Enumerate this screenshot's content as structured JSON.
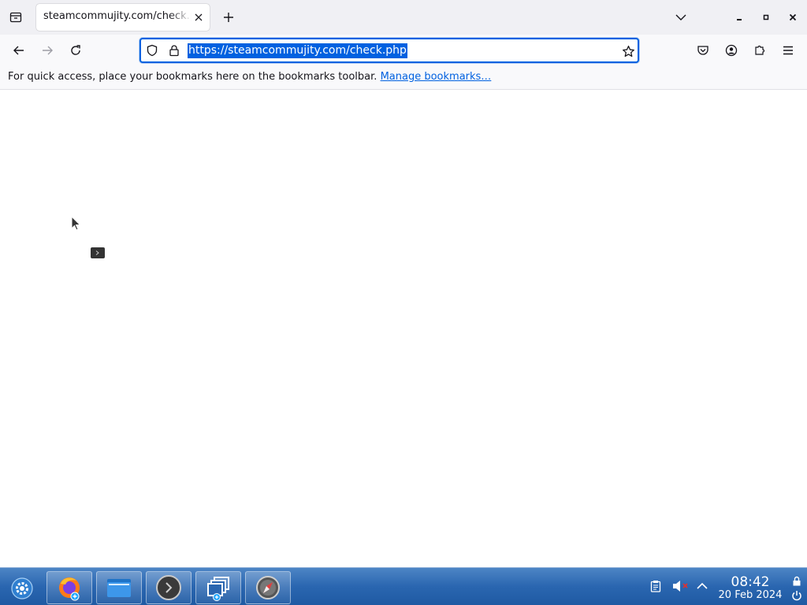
{
  "tab": {
    "title": "steamcommujity.com/check.php"
  },
  "urlbar": {
    "url": "https://steamcommujity.com/check.php"
  },
  "bookmarks": {
    "message": "For quick access, place your bookmarks here on the bookmarks toolbar.",
    "manage_link": "Manage bookmarks…"
  },
  "taskbar": {
    "apps": [
      "firefox-icon",
      "file-manager-icon",
      "terminal-icon",
      "windows-icon",
      "browser-compass-icon"
    ],
    "tray": [
      "clipboard-icon",
      "volume-muted-icon",
      "chevron-up-icon"
    ],
    "time": "08:42",
    "date": "20 Feb 2024"
  },
  "colors": {
    "accent": "#0061e0",
    "taskbar": "#2a66b0"
  }
}
